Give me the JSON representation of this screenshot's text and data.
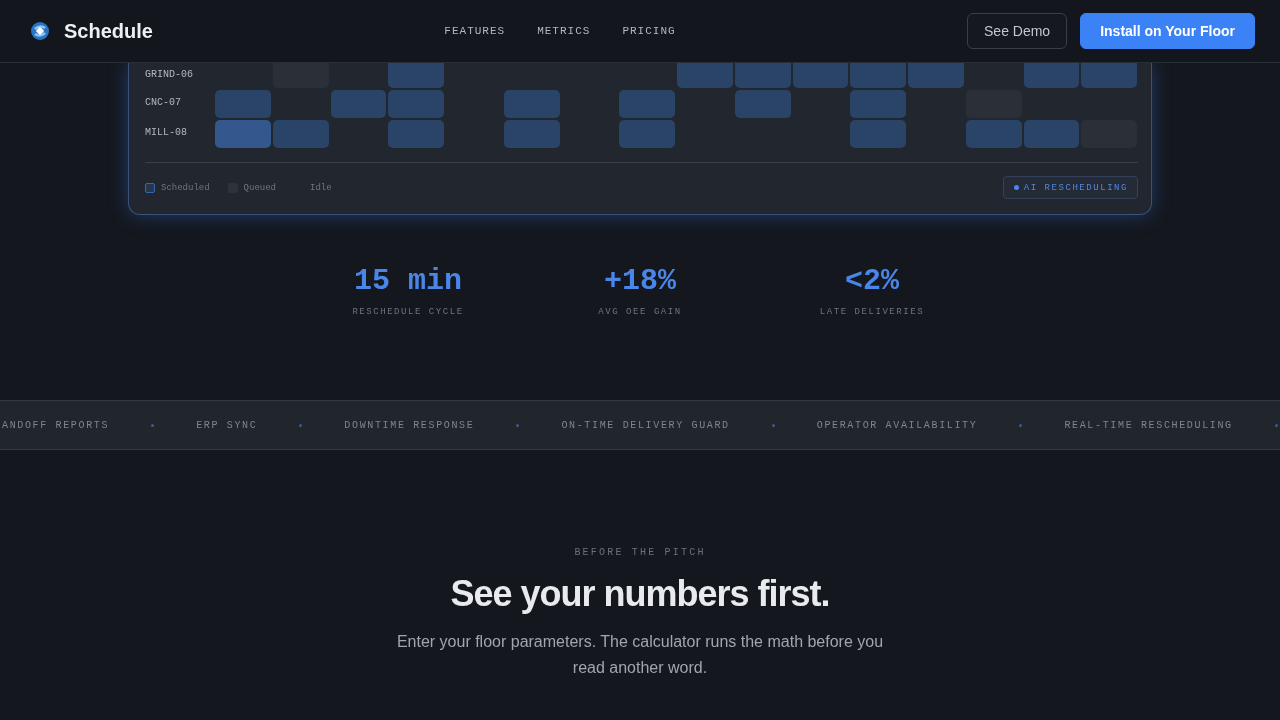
{
  "header": {
    "brand": "Schedule",
    "nav": [
      "FEATURES",
      "METRICS",
      "PRICING"
    ],
    "buttons": [
      {
        "label": "See Demo",
        "kind": "secondary"
      },
      {
        "label": "Install on Your Floor",
        "kind": "primary"
      }
    ]
  },
  "schedule_card": {
    "rows": [
      {
        "machine": "GRIND-06",
        "cells": [
          {
            "kind": "idle"
          },
          {
            "kind": "queued"
          },
          {
            "kind": "idle"
          },
          {
            "kind": "scheduled"
          },
          {
            "kind": "idle"
          },
          {
            "kind": "idle"
          },
          {
            "kind": "idle"
          },
          {
            "kind": "idle"
          },
          {
            "kind": "scheduled"
          },
          {
            "kind": "scheduled"
          },
          {
            "kind": "scheduled"
          },
          {
            "kind": "scheduled"
          },
          {
            "kind": "scheduled"
          },
          {
            "kind": "idle"
          },
          {
            "kind": "scheduled"
          },
          {
            "kind": "scheduled"
          }
        ]
      },
      {
        "machine": "CNC-07",
        "cells": [
          {
            "kind": "scheduled"
          },
          {
            "kind": "idle"
          },
          {
            "kind": "scheduled"
          },
          {
            "kind": "scheduled"
          },
          {
            "kind": "idle"
          },
          {
            "kind": "scheduled"
          },
          {
            "kind": "idle"
          },
          {
            "kind": "scheduled"
          },
          {
            "kind": "idle"
          },
          {
            "kind": "scheduled"
          },
          {
            "kind": "idle"
          },
          {
            "kind": "scheduled"
          },
          {
            "kind": "idle"
          },
          {
            "kind": "queued"
          },
          {
            "kind": "idle"
          },
          {
            "kind": "idle"
          }
        ]
      },
      {
        "machine": "MILL-08",
        "cells": [
          {
            "kind": "active"
          },
          {
            "kind": "scheduled"
          },
          {
            "kind": "idle"
          },
          {
            "kind": "scheduled"
          },
          {
            "kind": "idle"
          },
          {
            "kind": "scheduled"
          },
          {
            "kind": "idle"
          },
          {
            "kind": "scheduled"
          },
          {
            "kind": "idle"
          },
          {
            "kind": "idle"
          },
          {
            "kind": "idle"
          },
          {
            "kind": "scheduled"
          },
          {
            "kind": "idle"
          },
          {
            "kind": "scheduled"
          },
          {
            "kind": "scheduled"
          },
          {
            "kind": "queued"
          }
        ]
      }
    ],
    "legend": [
      {
        "label": "Scheduled",
        "kind": "scheduled"
      },
      {
        "label": "Queued",
        "kind": "queued"
      },
      {
        "label": "Idle",
        "kind": "idle"
      }
    ],
    "badge": "AI RESCHEDULING"
  },
  "stats": [
    {
      "value": "15 min",
      "label": "RESCHEDULE CYCLE"
    },
    {
      "value": "+18%",
      "label": "AVG OEE GAIN"
    },
    {
      "value": "<2%",
      "label": "LATE DELIVERIES"
    }
  ],
  "ticker": [
    "ANDOFF REPORTS",
    "ERP SYNC",
    "DOWNTIME RESPONSE",
    "ON-TIME DELIVERY GUARD",
    "OPERATOR AVAILABILITY",
    "REAL-TIME RESCHEDULING"
  ],
  "section": {
    "eyebrow": "BEFORE THE PITCH",
    "heading": "See your numbers first.",
    "text": "Enter your floor parameters. The calculator runs the math before you read another word."
  }
}
